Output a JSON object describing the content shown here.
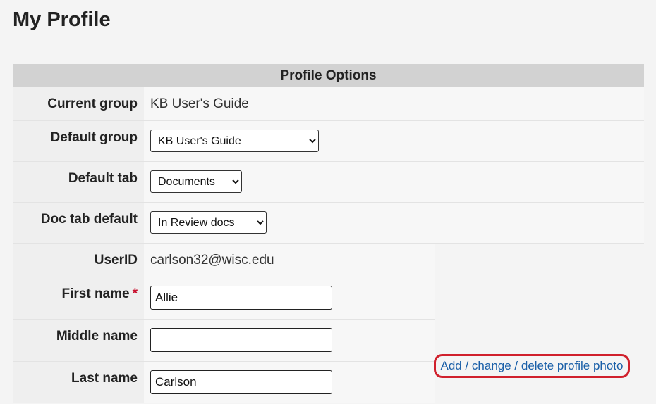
{
  "page": {
    "title": "My Profile"
  },
  "options": {
    "header": "Profile Options",
    "current_group": {
      "label": "Current group",
      "value": "KB User's Guide"
    },
    "default_group": {
      "label": "Default group",
      "selected": "KB User's Guide"
    },
    "default_tab": {
      "label": "Default tab",
      "selected": "Documents"
    },
    "doc_tab_default": {
      "label": "Doc tab default",
      "selected": "In Review docs"
    },
    "userid": {
      "label": "UserID",
      "value": "carlson32@wisc.edu"
    },
    "first_name": {
      "label": "First name",
      "required_mark": "*",
      "value": "Allie"
    },
    "middle_name": {
      "label": "Middle name",
      "value": ""
    },
    "last_name": {
      "label": "Last name",
      "value": "Carlson"
    }
  },
  "photo": {
    "link_label": "Add / change / delete profile photo",
    "highlight_color": "#d0202c",
    "link_color": "#1a5fa8"
  }
}
